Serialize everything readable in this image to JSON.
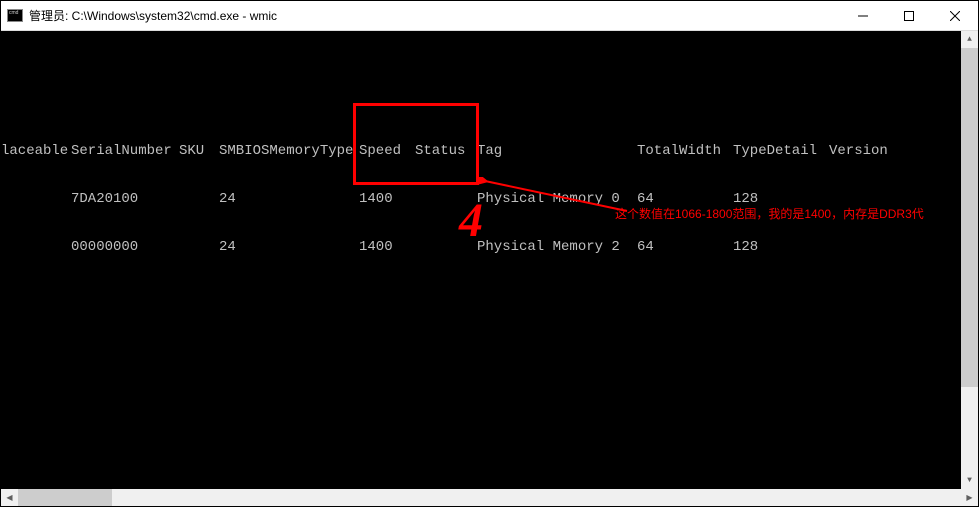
{
  "window": {
    "title": "管理员: C:\\Windows\\system32\\cmd.exe - wmic"
  },
  "columns": {
    "c0": "laceable",
    "c1": "SerialNumber",
    "c2": "SKU",
    "c3": "SMBIOSMemoryType",
    "c4": "Speed",
    "c5": "Status",
    "c6": "Tag",
    "c7": "TotalWidth",
    "c8": "TypeDetail",
    "c9": "Version"
  },
  "rows": [
    {
      "c0": "",
      "c1": "7DA20100",
      "c2": "",
      "c3": "24",
      "c4": "1400",
      "c5": "",
      "c6": "Physical Memory 0",
      "c7": "64",
      "c8": "128",
      "c9": ""
    },
    {
      "c0": "",
      "c1": "00000000",
      "c2": "",
      "c3": "24",
      "c4": "1400",
      "c5": "",
      "c6": "Physical Memory 2",
      "c7": "64",
      "c8": "128",
      "c9": ""
    }
  ],
  "annotation": {
    "step": "4",
    "text": "这个数值在1066-1800范围，我的是1400，内存是DDR3代"
  }
}
